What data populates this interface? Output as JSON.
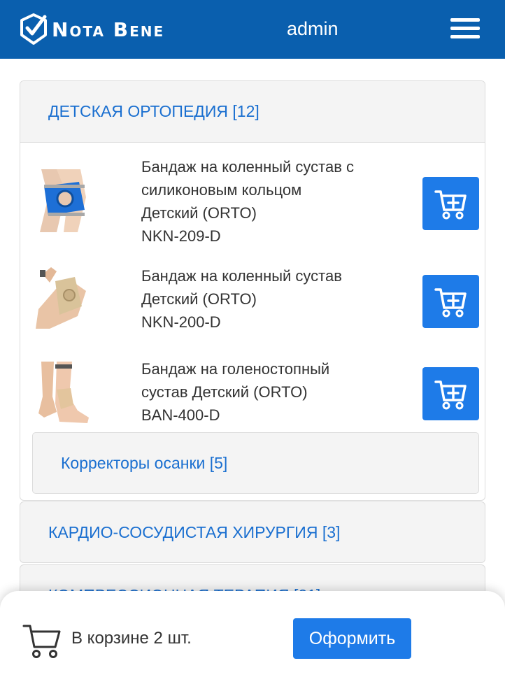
{
  "header": {
    "logo_text": "Nota Bene",
    "username": "admin",
    "brand_color": "#0a5fae"
  },
  "category": {
    "title": "ДЕТСКАЯ ОРТОПЕДИЯ [12]",
    "products": [
      {
        "lines": [
          "Бандаж на коленный сустав с",
          "силиконовым кольцом",
          "Детский (ORTO)",
          "NKN-209-D"
        ],
        "image_icon": "knee-brace-blue-image"
      },
      {
        "lines": [
          "Бандаж на коленный сустав",
          "Детский (ORTO)",
          "NKN-200-D"
        ],
        "image_icon": "knee-brace-beige-image"
      },
      {
        "lines": [
          "Бандаж на голеностопный",
          "сустав Детский (ORTO)",
          "BAN-400-D"
        ],
        "image_icon": "ankle-brace-image"
      }
    ],
    "subcategory": "Корректоры осанки [5]"
  },
  "other_categories": [
    "КАРДИО-СОСУДИСТАЯ ХИРУРГИЯ [3]",
    "КОМПРЕССИОННАЯ ТЕРАПИЯ [21]"
  ],
  "cart": {
    "text": "В корзине 2 шт.",
    "checkout_label": "Оформить",
    "accent_color": "#1e7be8"
  }
}
